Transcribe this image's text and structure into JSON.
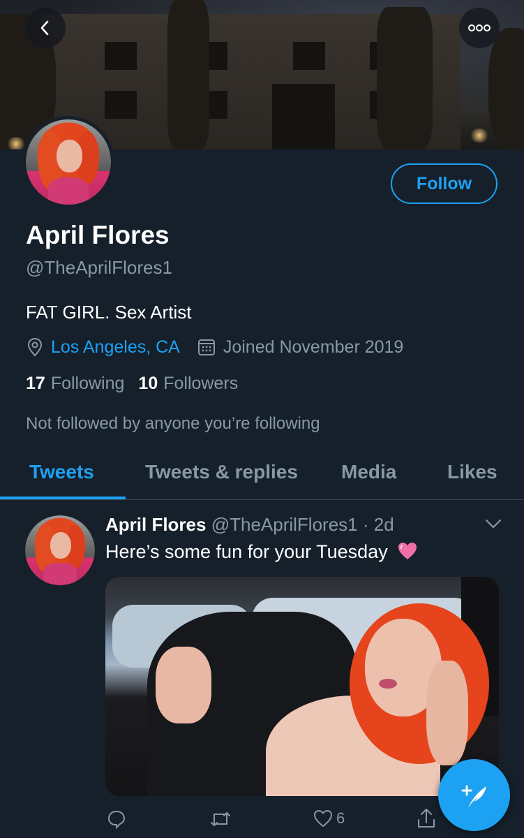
{
  "header": {
    "back_icon": "chevron-left-icon",
    "more_icon": "more-horizontal-icon"
  },
  "profile": {
    "name": "April Flores",
    "handle": "@TheAprilFlores1",
    "bio": "FAT GIRL. Sex Artist",
    "location": "Los Angeles, CA",
    "joined": "Joined November 2019",
    "following_count": "17",
    "following_label": "Following",
    "followers_count": "10",
    "followers_label": "Followers",
    "follow_note": "Not followed by anyone you’re following",
    "follow_button": "Follow"
  },
  "tabs": [
    {
      "label": "Tweets",
      "active": true
    },
    {
      "label": "Tweets & replies",
      "active": false
    },
    {
      "label": "Media",
      "active": false
    },
    {
      "label": "Likes",
      "active": false
    }
  ],
  "tweet": {
    "author": "April Flores",
    "handle_time": "@TheAprilFlores1 · 2d",
    "text": "Here’s some fun for your Tuesday",
    "emoji": "pink-heart",
    "like_count": "6"
  },
  "colors": {
    "background": "#15202b",
    "accent": "#1da1f2",
    "secondary_text": "#8899a6",
    "divider": "#38444d"
  }
}
